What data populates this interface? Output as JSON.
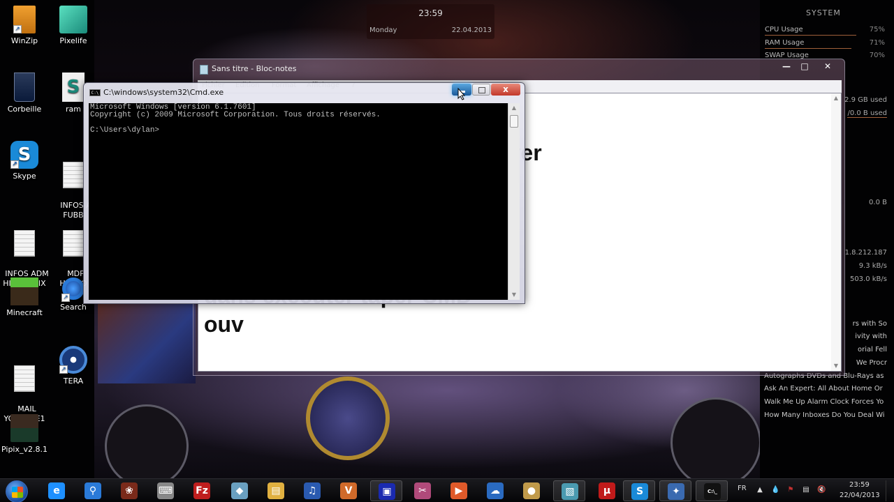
{
  "desktop": {
    "icons": [
      {
        "label": "WinZip",
        "icon": "winzip-icon",
        "shortcut": true
      },
      {
        "label": "Pixelife",
        "icon": "cube-icon",
        "shortcut": false
      },
      {
        "label": "Corbeille",
        "icon": "recycle-bin-icon",
        "shortcut": false
      },
      {
        "label": "ram",
        "icon": "script-icon",
        "shortcut": false
      },
      {
        "label": "Skype",
        "icon": "skype-icon",
        "shortcut": true
      },
      {
        "label": "INFOS A\nFUBB",
        "icon": "document-icon",
        "shortcut": false
      },
      {
        "label": "INFOS ADM\nHIABBOUIX",
        "icon": "document-icon",
        "shortcut": false
      },
      {
        "label": "MDP\nHABBO",
        "icon": "document-icon",
        "shortcut": false
      },
      {
        "label": "Minecraft",
        "icon": "minecraft-icon",
        "shortcut": false
      },
      {
        "label": "Search",
        "icon": "search-icon",
        "shortcut": true
      },
      {
        "label": "MAIL\nYOUTUBE1",
        "icon": "document-icon",
        "shortcut": false
      },
      {
        "label": "TERA",
        "icon": "tera-icon",
        "shortcut": true
      },
      {
        "label": "Pipix_v2.8.1",
        "icon": "pipix-icon",
        "shortcut": false
      }
    ]
  },
  "clock_widget": {
    "time": "23:59",
    "day": "Monday",
    "date": "22.04.2013"
  },
  "system_widget": {
    "title": "SYSTEM",
    "rows": [
      {
        "label": "CPU Usage",
        "value": "75%",
        "percent": 75
      },
      {
        "label": "RAM Usage",
        "value": "71%",
        "percent": 71
      },
      {
        "label": "SWAP Usage",
        "value": "70%",
        "percent": 70
      }
    ],
    "ram_used": "2.9 GB used",
    "swap_used": "/0.0 B used",
    "disk": "0.0 B",
    "ip": "1.8.212.187",
    "upload": "9.3 kB/s",
    "download": "503.0 kB/s"
  },
  "news_feed": [
    "rs with So",
    "ivity with",
    "orial Fell",
    "We Procr",
    "Autographs DVDs and Blu-Rays as",
    "Ask An Expert: All About Home Or",
    "Walk Me Up Alarm Clock Forces Yo",
    "How Many Inboxes Do You Deal Wi"
  ],
  "notepad": {
    "title": "Sans titre - Bloc-notes",
    "menu": [
      "Fichier",
      "Edition",
      "Format",
      "Affichage",
      "?"
    ],
    "controls": {
      "minimize": "—",
      "maximize": "□",
      "close": "✕"
    },
    "text": "        é mon       \n                  trer comment trouver\n                  ro habbo.\n\n\n\ndans executer taper CMD\nouv"
  },
  "cmd": {
    "title": "C:\\windows\\system32\\Cmd.exe",
    "icon_text": "C:\\",
    "close": "x",
    "output": "Microsoft Windows [version 6.1.7601]\nCopyright (c) 2009 Microsoft Corporation. Tous droits réservés.\n\nC:\\Users\\dylan>"
  },
  "taskbar": {
    "pinned": [
      {
        "name": "internet-explorer",
        "glyph": "e",
        "color": "#1e90ff"
      },
      {
        "name": "search",
        "glyph": "⚲",
        "color": "#2a7ad8"
      },
      {
        "name": "audio",
        "glyph": "❀",
        "color": "#7a2a1a"
      },
      {
        "name": "on-screen-keyboard",
        "glyph": "⌨",
        "color": "#888888"
      },
      {
        "name": "filezilla",
        "glyph": "Fz",
        "color": "#bf1e1e"
      },
      {
        "name": "water-drop",
        "glyph": "◆",
        "color": "#6aa0c0"
      },
      {
        "name": "file-explorer",
        "glyph": "▤",
        "color": "#e0b040"
      },
      {
        "name": "itunes",
        "glyph": "♫",
        "color": "#2a5ab0"
      },
      {
        "name": "vegas",
        "glyph": "V",
        "color": "#d06a2a"
      },
      {
        "name": "remote-app",
        "glyph": "▣",
        "color": "#1a2ab0"
      },
      {
        "name": "snipping-tool",
        "glyph": "✂",
        "color": "#b04a7a"
      },
      {
        "name": "media-player",
        "glyph": "▶",
        "color": "#e05a2a"
      },
      {
        "name": "openoffice",
        "glyph": "☁",
        "color": "#2a6ac0"
      },
      {
        "name": "paint",
        "glyph": "●",
        "color": "#c09a4a"
      },
      {
        "name": "notepad",
        "glyph": "▧",
        "color": "#4a9ab0"
      },
      {
        "name": "utorrent",
        "glyph": "μ",
        "color": "#c01a1a"
      },
      {
        "name": "skype",
        "glyph": "S",
        "color": "#1a8ad8"
      },
      {
        "name": "tera",
        "glyph": "✦",
        "color": "#3a6ab0"
      },
      {
        "name": "cmd",
        "glyph": "C:\\_",
        "color": "#111111"
      }
    ],
    "language": "FR",
    "tray_time": "23:59",
    "tray_date": "22/04/2013"
  }
}
